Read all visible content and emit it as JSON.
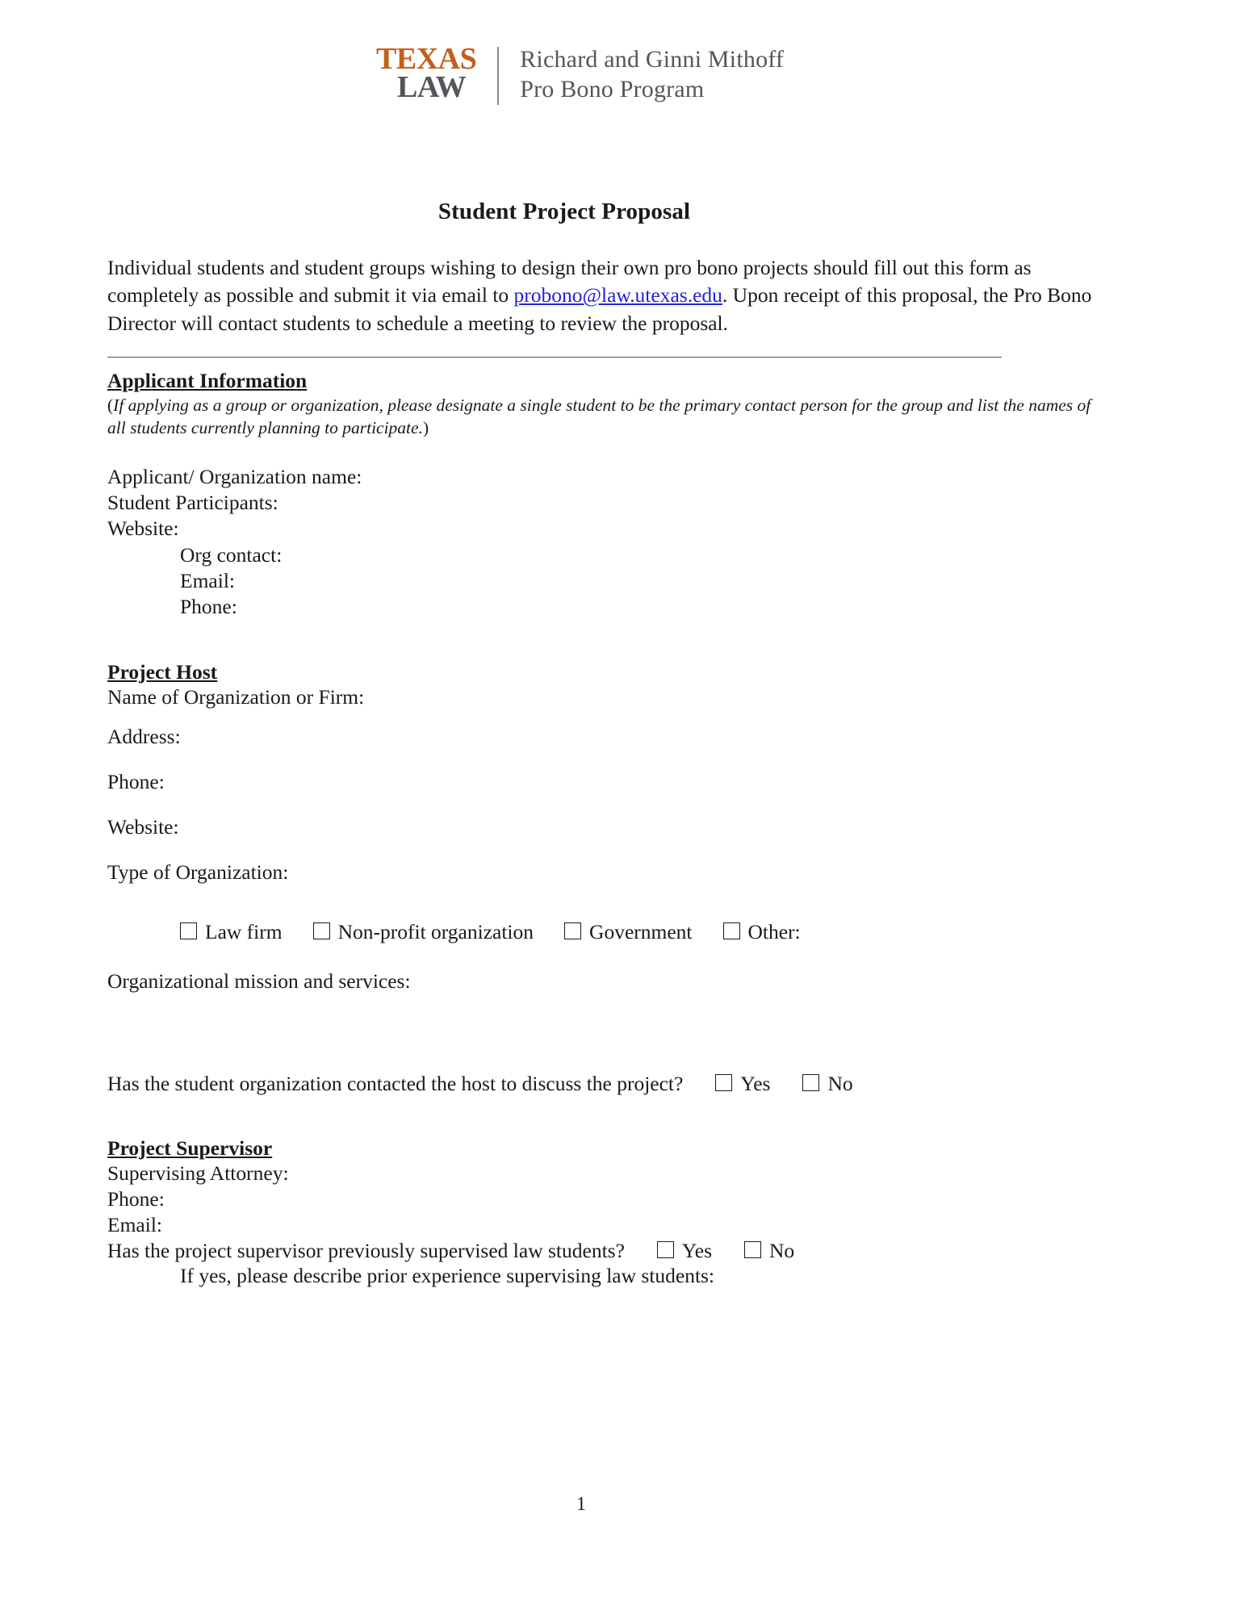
{
  "header": {
    "logo": {
      "texas": "TEXAS",
      "law": "LAW",
      "line1": "Richard and Ginni Mithoff",
      "line2": "Pro Bono Program",
      "texas_color": "#c4601c",
      "law_color": "#53565a"
    }
  },
  "document": {
    "title": "Student Project Proposal",
    "intro_before_link": "Individual students and student groups wishing to design their own pro bono projects should fill out this form as completely as possible and submit it via email to ",
    "intro_link": "probono@law.utexas.edu",
    "intro_after_link": ".  Upon receipt of this proposal, the Pro Bono Director will contact students to schedule a meeting to review the proposal.",
    "link_color": "#2222dd",
    "page_number": "1"
  },
  "applicant_information": {
    "heading": "Applicant Information",
    "note": "(If applying as a group or organization, please designate a single student to be the primary contact person for the group and list the names of all students currently planning to participate.)",
    "note_italic": "If applying as a group or organization, please designate a single student to be the primary contact person for the group and list the names of all students currently planning to participate.",
    "fields": [
      "Applicant/ Organization name:",
      "Student Participants:",
      "Website:"
    ],
    "indented_fields": [
      "Org contact:",
      "Email:",
      "Phone:"
    ]
  },
  "project_host": {
    "heading": "Project Host",
    "name_field": "Name of Organization or Firm:",
    "fields": [
      "Address:",
      "Phone:",
      "Website:",
      "Type of Organization:"
    ],
    "org_type_options": [
      "Law firm",
      "Non-profit organization",
      "Government",
      "Other:"
    ],
    "mission_field": "Organizational mission and services:",
    "contacted_question": "Has the student organization contacted the host to discuss the project?",
    "contacted_options": [
      "Yes",
      "No"
    ]
  },
  "project_supervisor": {
    "heading": "Project Supervisor",
    "fields": [
      "Supervising Attorney:",
      "Phone:",
      "Email:"
    ],
    "supervised_question": "Has the project supervisor previously supervised law students?",
    "supervised_options": [
      "Yes",
      "No"
    ],
    "if_yes_note": "If yes, please describe prior experience supervising law students:"
  }
}
